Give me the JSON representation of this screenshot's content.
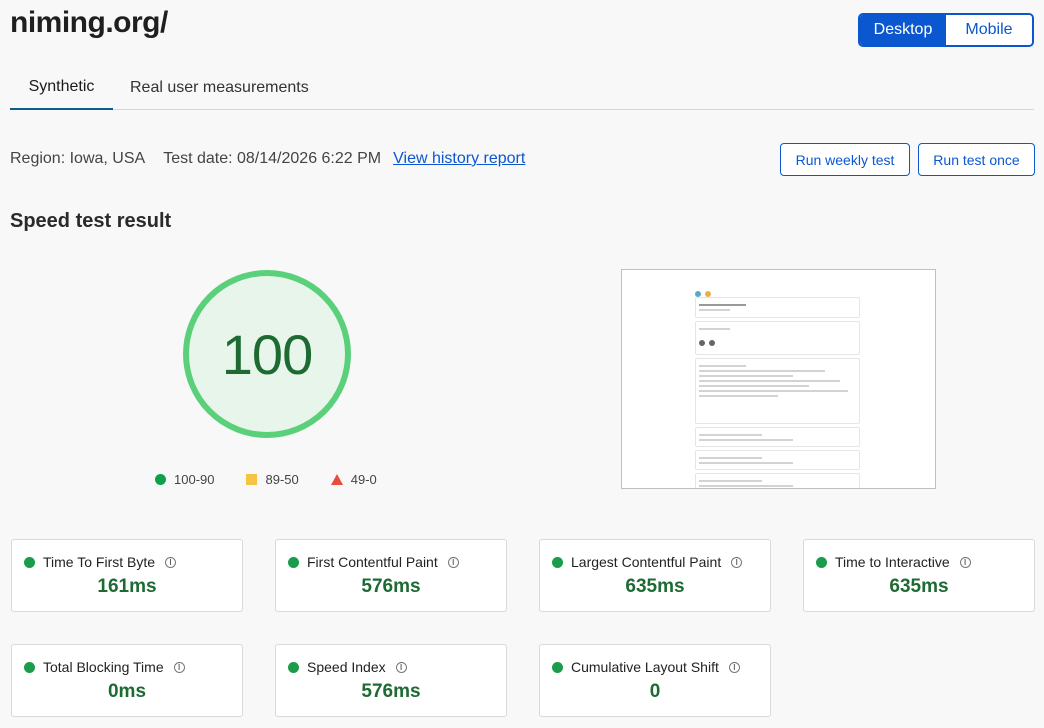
{
  "site": {
    "title": "niming.org/"
  },
  "device_toggle": {
    "desktop": "Desktop",
    "mobile": "Mobile",
    "selected": "Desktop"
  },
  "tabs": [
    {
      "label": "Synthetic",
      "active": true
    },
    {
      "label": "Real user measurements",
      "active": false
    }
  ],
  "meta": {
    "region": "Region: Iowa, USA",
    "test_date": "Test date: 08/14/2026 6:22 PM",
    "history_link": "View history report"
  },
  "actions": {
    "weekly": "Run weekly test",
    "once": "Run test once"
  },
  "result": {
    "title": "Speed test result",
    "score": "100",
    "legend": [
      {
        "label": "100-90",
        "icon": "green-circle"
      },
      {
        "label": "89-50",
        "icon": "yellow-square"
      },
      {
        "label": "49-0",
        "icon": "red-triangle"
      }
    ]
  },
  "metrics": [
    {
      "label": "Time To First Byte",
      "value": "161ms"
    },
    {
      "label": "First Contentful Paint",
      "value": "576ms"
    },
    {
      "label": "Largest Contentful Paint",
      "value": "635ms"
    },
    {
      "label": "Time to Interactive",
      "value": "635ms"
    },
    {
      "label": "Total Blocking Time",
      "value": "0ms"
    },
    {
      "label": "Speed Index",
      "value": "576ms"
    },
    {
      "label": "Cumulative Layout Shift",
      "value": "0"
    }
  ],
  "colors": {
    "accent": "#0b57d0",
    "good": "#1a9c4a",
    "score_text": "#1d6a33"
  }
}
